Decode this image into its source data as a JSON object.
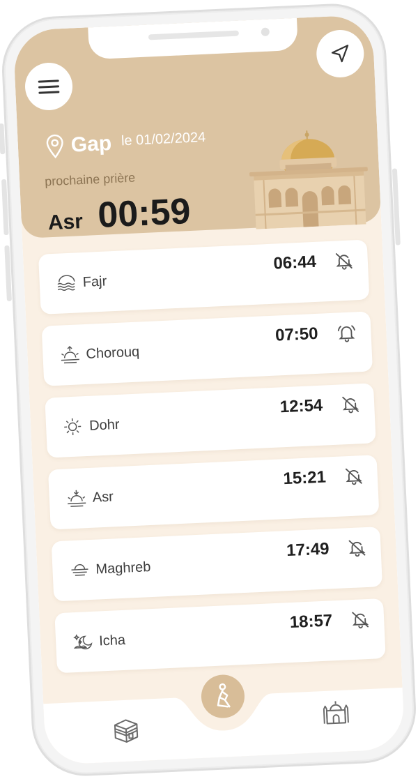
{
  "header": {
    "city": "Gap",
    "date": "le 01/02/2024",
    "next_prayer_label": "prochaine prière",
    "next_prayer_name": "Asr",
    "countdown": "00:59"
  },
  "prayers": [
    {
      "name": "Fajr",
      "time": "06:44",
      "icon": "fajr-waves-icon",
      "notification": "off"
    },
    {
      "name": "Chorouq",
      "time": "07:50",
      "icon": "sunrise-icon",
      "notification": "on"
    },
    {
      "name": "Dohr",
      "time": "12:54",
      "icon": "sun-icon",
      "notification": "off"
    },
    {
      "name": "Asr",
      "time": "15:21",
      "icon": "sun-down-icon",
      "notification": "off"
    },
    {
      "name": "Maghreb",
      "time": "17:49",
      "icon": "sunset-icon",
      "notification": "off"
    },
    {
      "name": "Icha",
      "time": "18:57",
      "icon": "moon-stars-icon",
      "notification": "off"
    }
  ],
  "tabs": [
    {
      "icon": "kaaba-icon"
    },
    {
      "icon": "praying-person-icon",
      "active": true
    },
    {
      "icon": "mosque-icon"
    }
  ],
  "colors": {
    "header": "#dcc4a2",
    "background": "#faf0e4",
    "accent": "#d8bd98"
  }
}
